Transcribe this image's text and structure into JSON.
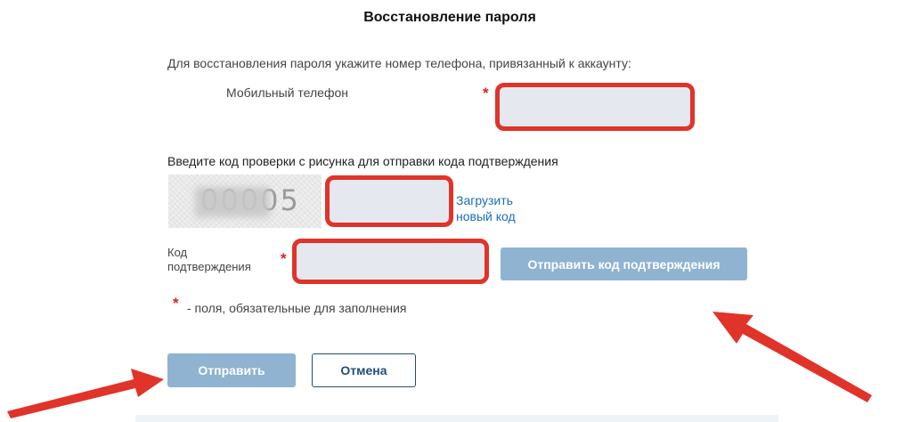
{
  "page": {
    "title": "Восстановление пароля",
    "instruction": "Для восстановления пароля укажите номер телефона, привязанный к аккаунту:"
  },
  "form": {
    "phone_label": "Мобильный телефон",
    "phone_value": "",
    "required_star": "*",
    "captcha_heading": "Введите код проверки с рисунка для отправки кода подтверждения",
    "captcha_image_text": "00005",
    "captcha_value": "",
    "reload_link_line1": "Загрузить",
    "reload_link_line2": "новый код",
    "code_label_line1": "Код",
    "code_label_line2": "подтверждения",
    "code_value": "",
    "send_code_button": "Отправить код подтверждения",
    "required_note": "- поля, обязательные для заполнения"
  },
  "actions": {
    "submit_label": "Отправить",
    "cancel_label": "Отмена"
  },
  "colors": {
    "highlight_red": "#e0332a",
    "button_disabled_blue": "#8fb3d1",
    "link_blue": "#1a6fb5",
    "arrow_red": "#e0332a"
  }
}
